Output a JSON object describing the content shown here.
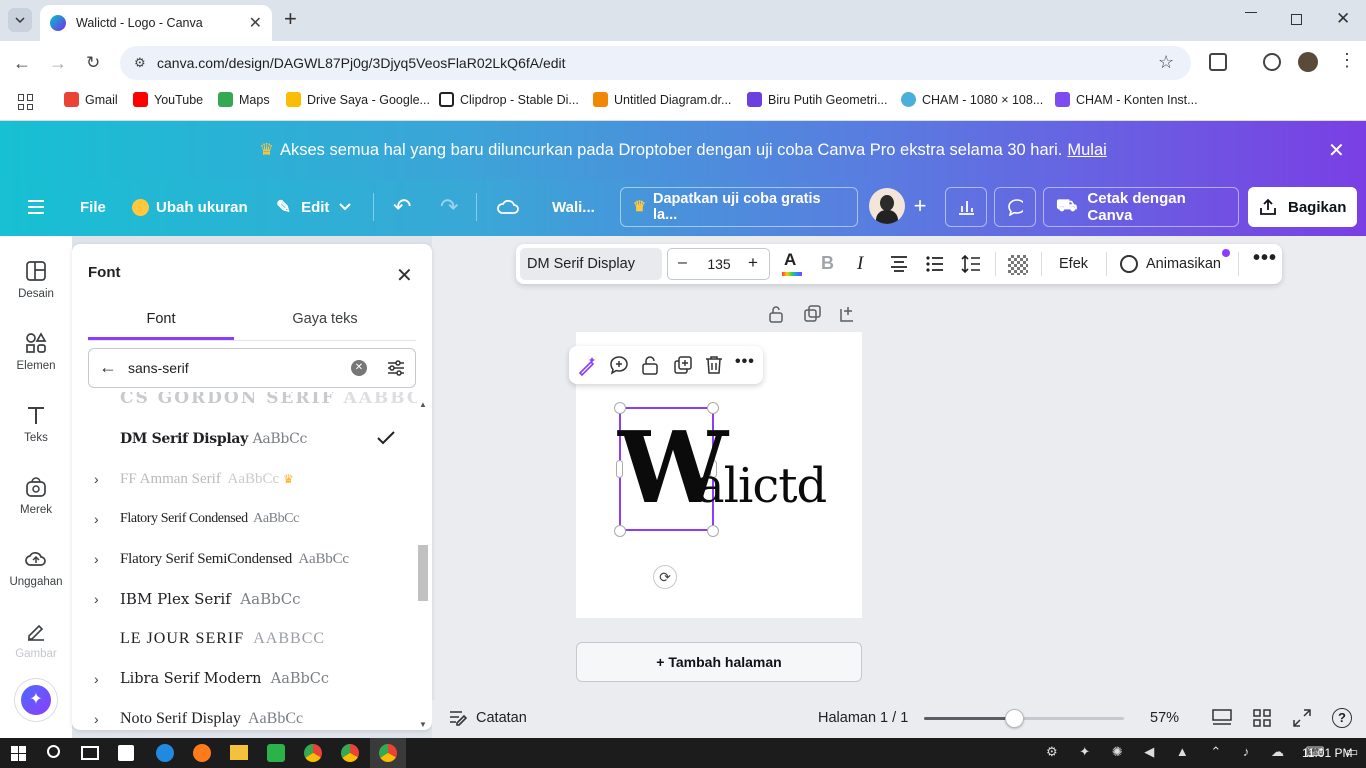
{
  "browser": {
    "tab_title": "Walictd - Logo - Canva",
    "url": "canva.com/design/DAGWL87Pj0g/3Djyq5VeosFlaR02LkQ6fA/edit",
    "bookmarks": [
      "Gmail",
      "YouTube",
      "Maps",
      "Drive Saya - Google...",
      "Clipdrop - Stable Di...",
      "Untitled Diagram.dr...",
      "Biru Putih Geometri...",
      "CHAM - 1080 × 108...",
      "CHAM - Konten Inst..."
    ]
  },
  "promo": {
    "text": "Akses semua hal yang baru diluncurkan pada Droptober dengan uji coba Canva Pro ekstra selama 30 hari.",
    "link": "Mulai"
  },
  "topbar": {
    "file": "File",
    "resize": "Ubah ukuran",
    "edit": "Edit",
    "design_title": "Wali...",
    "trial": "Dapatkan uji coba gratis la...",
    "print": "Cetak dengan Canva",
    "share": "Bagikan"
  },
  "sidebar": {
    "items": [
      "Desain",
      "Elemen",
      "Teks",
      "Merek",
      "Unggahan",
      "Gambar"
    ]
  },
  "panel": {
    "title": "Font",
    "tabs": [
      "Font",
      "Gaya teks"
    ],
    "search_value": "sans-serif",
    "fonts": [
      {
        "name": "CS GORDON SERIF",
        "sample": "AABBC"
      },
      {
        "name": "DM Serif Display",
        "sample": "AaBbCc"
      },
      {
        "name": "FF Amman Serif",
        "sample": "AaBbCc"
      },
      {
        "name": "Flatory Serif Condensed",
        "sample": "AaBbCc"
      },
      {
        "name": "Flatory Serif SemiCondensed",
        "sample": "AaBbCc"
      },
      {
        "name": "IBM Plex Serif",
        "sample": "AaBbCc"
      },
      {
        "name": "LE JOUR SERIF",
        "sample": "AABBCC"
      },
      {
        "name": "Libra Serif Modern",
        "sample": "AaBbCc"
      },
      {
        "name": "Noto Serif Display",
        "sample": "AaBbCc"
      }
    ]
  },
  "textbar": {
    "font": "DM Serif Display",
    "size": "135",
    "effects": "Efek",
    "animate": "Animasikan"
  },
  "canvas": {
    "big_letter": "W",
    "rest": "alictd",
    "add_page": "+ Tambah halaman"
  },
  "bottom": {
    "notes": "Catatan",
    "page": "Halaman 1 / 1",
    "zoom": "57%",
    "zoom_level": 0.45
  },
  "taskbar": {
    "time": "11:01 PM"
  },
  "colors": {
    "accent": "#8b3dff",
    "teal": "#17c0d3"
  }
}
